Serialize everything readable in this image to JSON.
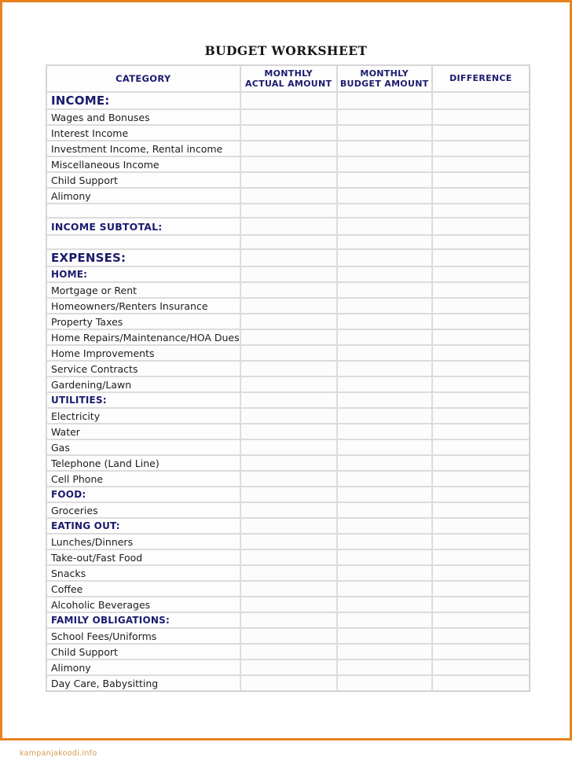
{
  "document": {
    "title": "BUDGET WORKSHEET",
    "watermark": "kampanjakoodi.info",
    "accent_border_color": "#e8821e",
    "heading_color": "#1b1b6e",
    "watermark_color": "#d79a4e"
  },
  "table": {
    "columns": [
      {
        "key": "category",
        "label": "CATEGORY"
      },
      {
        "key": "actual",
        "label": "MONTHLY\nACTUAL AMOUNT",
        "line1": "MONTHLY",
        "line2": "ACTUAL AMOUNT"
      },
      {
        "key": "budget",
        "label": "MONTHLY\nBUDGET AMOUNT",
        "line1": "MONTHLY",
        "line2": "BUDGET AMOUNT"
      },
      {
        "key": "difference",
        "label": "DIFFERENCE"
      }
    ],
    "rows": [
      {
        "label": "INCOME:",
        "style": "major",
        "actual": "",
        "budget": "",
        "difference": ""
      },
      {
        "label": "Wages and Bonuses",
        "style": "item",
        "actual": "",
        "budget": "",
        "difference": ""
      },
      {
        "label": "Interest Income",
        "style": "item",
        "actual": "",
        "budget": "",
        "difference": ""
      },
      {
        "label": "Investment Income, Rental income",
        "style": "item",
        "actual": "",
        "budget": "",
        "difference": ""
      },
      {
        "label": "Miscellaneous Income",
        "style": "item",
        "actual": "",
        "budget": "",
        "difference": ""
      },
      {
        "label": "Child Support",
        "style": "item",
        "actual": "",
        "budget": "",
        "difference": ""
      },
      {
        "label": "Alimony",
        "style": "item",
        "actual": "",
        "budget": "",
        "difference": ""
      },
      {
        "label": "",
        "style": "spacer",
        "actual": "",
        "budget": "",
        "difference": ""
      },
      {
        "label": "INCOME SUBTOTAL:",
        "style": "sub",
        "actual": "",
        "budget": "",
        "difference": ""
      },
      {
        "label": "",
        "style": "spacer",
        "actual": "",
        "budget": "",
        "difference": ""
      },
      {
        "label": "EXPENSES:",
        "style": "major",
        "actual": "",
        "budget": "",
        "difference": ""
      },
      {
        "label": "HOME:",
        "style": "minor",
        "actual": "",
        "budget": "",
        "difference": ""
      },
      {
        "label": "Mortgage or Rent",
        "style": "item",
        "actual": "",
        "budget": "",
        "difference": ""
      },
      {
        "label": "Homeowners/Renters Insurance",
        "style": "item",
        "actual": "",
        "budget": "",
        "difference": ""
      },
      {
        "label": "Property Taxes",
        "style": "item",
        "actual": "",
        "budget": "",
        "difference": ""
      },
      {
        "label": "Home Repairs/Maintenance/HOA Dues",
        "style": "item",
        "actual": "",
        "budget": "",
        "difference": ""
      },
      {
        "label": "Home Improvements",
        "style": "item",
        "actual": "",
        "budget": "",
        "difference": ""
      },
      {
        "label": "Service Contracts",
        "style": "item",
        "actual": "",
        "budget": "",
        "difference": ""
      },
      {
        "label": "Gardening/Lawn",
        "style": "item",
        "actual": "",
        "budget": "",
        "difference": ""
      },
      {
        "label": "UTILITIES:",
        "style": "minor",
        "actual": "",
        "budget": "",
        "difference": ""
      },
      {
        "label": "Electricity",
        "style": "item",
        "actual": "",
        "budget": "",
        "difference": ""
      },
      {
        "label": "Water",
        "style": "item",
        "actual": "",
        "budget": "",
        "difference": ""
      },
      {
        "label": "Gas",
        "style": "item",
        "actual": "",
        "budget": "",
        "difference": ""
      },
      {
        "label": "Telephone (Land Line)",
        "style": "item",
        "actual": "",
        "budget": "",
        "difference": ""
      },
      {
        "label": "Cell Phone",
        "style": "item",
        "actual": "",
        "budget": "",
        "difference": ""
      },
      {
        "label": "FOOD:",
        "style": "minor",
        "actual": "",
        "budget": "",
        "difference": ""
      },
      {
        "label": "Groceries",
        "style": "item",
        "actual": "",
        "budget": "",
        "difference": ""
      },
      {
        "label": "EATING OUT:",
        "style": "minor",
        "actual": "",
        "budget": "",
        "difference": ""
      },
      {
        "label": "Lunches/Dinners",
        "style": "item",
        "actual": "",
        "budget": "",
        "difference": ""
      },
      {
        "label": "Take-out/Fast Food",
        "style": "item",
        "actual": "",
        "budget": "",
        "difference": ""
      },
      {
        "label": "Snacks",
        "style": "item",
        "actual": "",
        "budget": "",
        "difference": ""
      },
      {
        "label": "Coffee",
        "style": "item",
        "actual": "",
        "budget": "",
        "difference": ""
      },
      {
        "label": "Alcoholic Beverages",
        "style": "item",
        "actual": "",
        "budget": "",
        "difference": ""
      },
      {
        "label": "FAMILY OBLIGATIONS:",
        "style": "minor",
        "actual": "",
        "budget": "",
        "difference": ""
      },
      {
        "label": "School Fees/Uniforms",
        "style": "item",
        "actual": "",
        "budget": "",
        "difference": ""
      },
      {
        "label": "Child Support",
        "style": "item",
        "actual": "",
        "budget": "",
        "difference": ""
      },
      {
        "label": "Alimony",
        "style": "item",
        "actual": "",
        "budget": "",
        "difference": ""
      },
      {
        "label": "Day Care, Babysitting",
        "style": "item",
        "actual": "",
        "budget": "",
        "difference": ""
      }
    ]
  }
}
